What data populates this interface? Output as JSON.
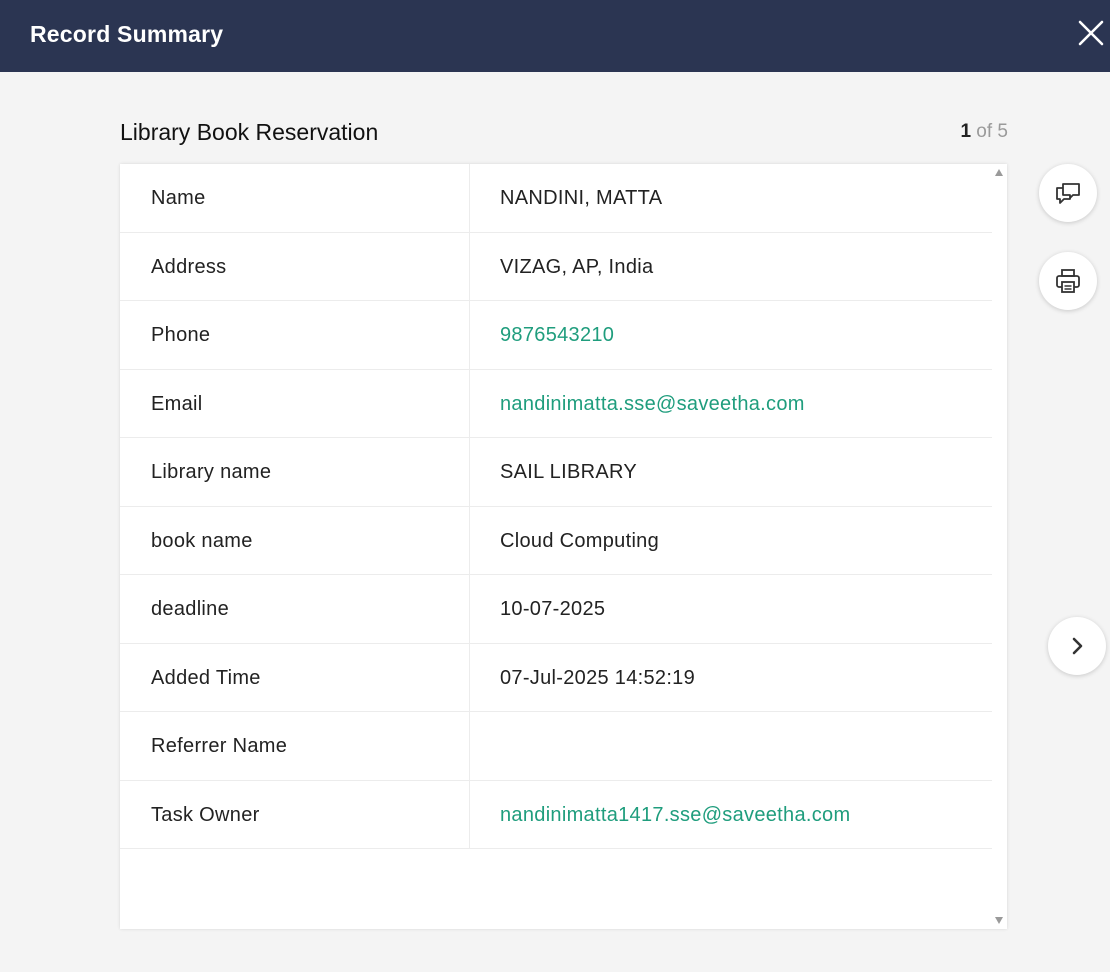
{
  "header": {
    "title": "Record Summary",
    "close_icon": "close-icon"
  },
  "form": {
    "title": "Library Book Reservation"
  },
  "pager": {
    "current": "1",
    "total_text": "of 5"
  },
  "fields": [
    {
      "label": "Name",
      "value": "NANDINI, MATTA",
      "link": false
    },
    {
      "label": "Address",
      "value": "VIZAG, AP, India",
      "link": false
    },
    {
      "label": "Phone",
      "value": "9876543210",
      "link": true
    },
    {
      "label": "Email",
      "value": "nandinimatta.sse@saveetha.com",
      "link": true
    },
    {
      "label": "Library name",
      "value": "SAIL LIBRARY",
      "link": false
    },
    {
      "label": "book name",
      "value": "Cloud Computing",
      "link": false
    },
    {
      "label": "deadline",
      "value": "10-07-2025",
      "link": false
    },
    {
      "label": "Added Time",
      "value": "07-Jul-2025 14:52:19",
      "link": false
    },
    {
      "label": "Referrer Name",
      "value": "",
      "link": false
    },
    {
      "label": "Task Owner",
      "value": "nandinimatta1417.sse@saveetha.com",
      "link": true
    }
  ],
  "actions": {
    "comment_icon": "comment-icon",
    "print_icon": "print-icon",
    "next_icon": "chevron-right-icon"
  },
  "colors": {
    "header_bg": "#2b3552",
    "link": "#1f9d7d",
    "page_bg": "#f4f4f4"
  }
}
